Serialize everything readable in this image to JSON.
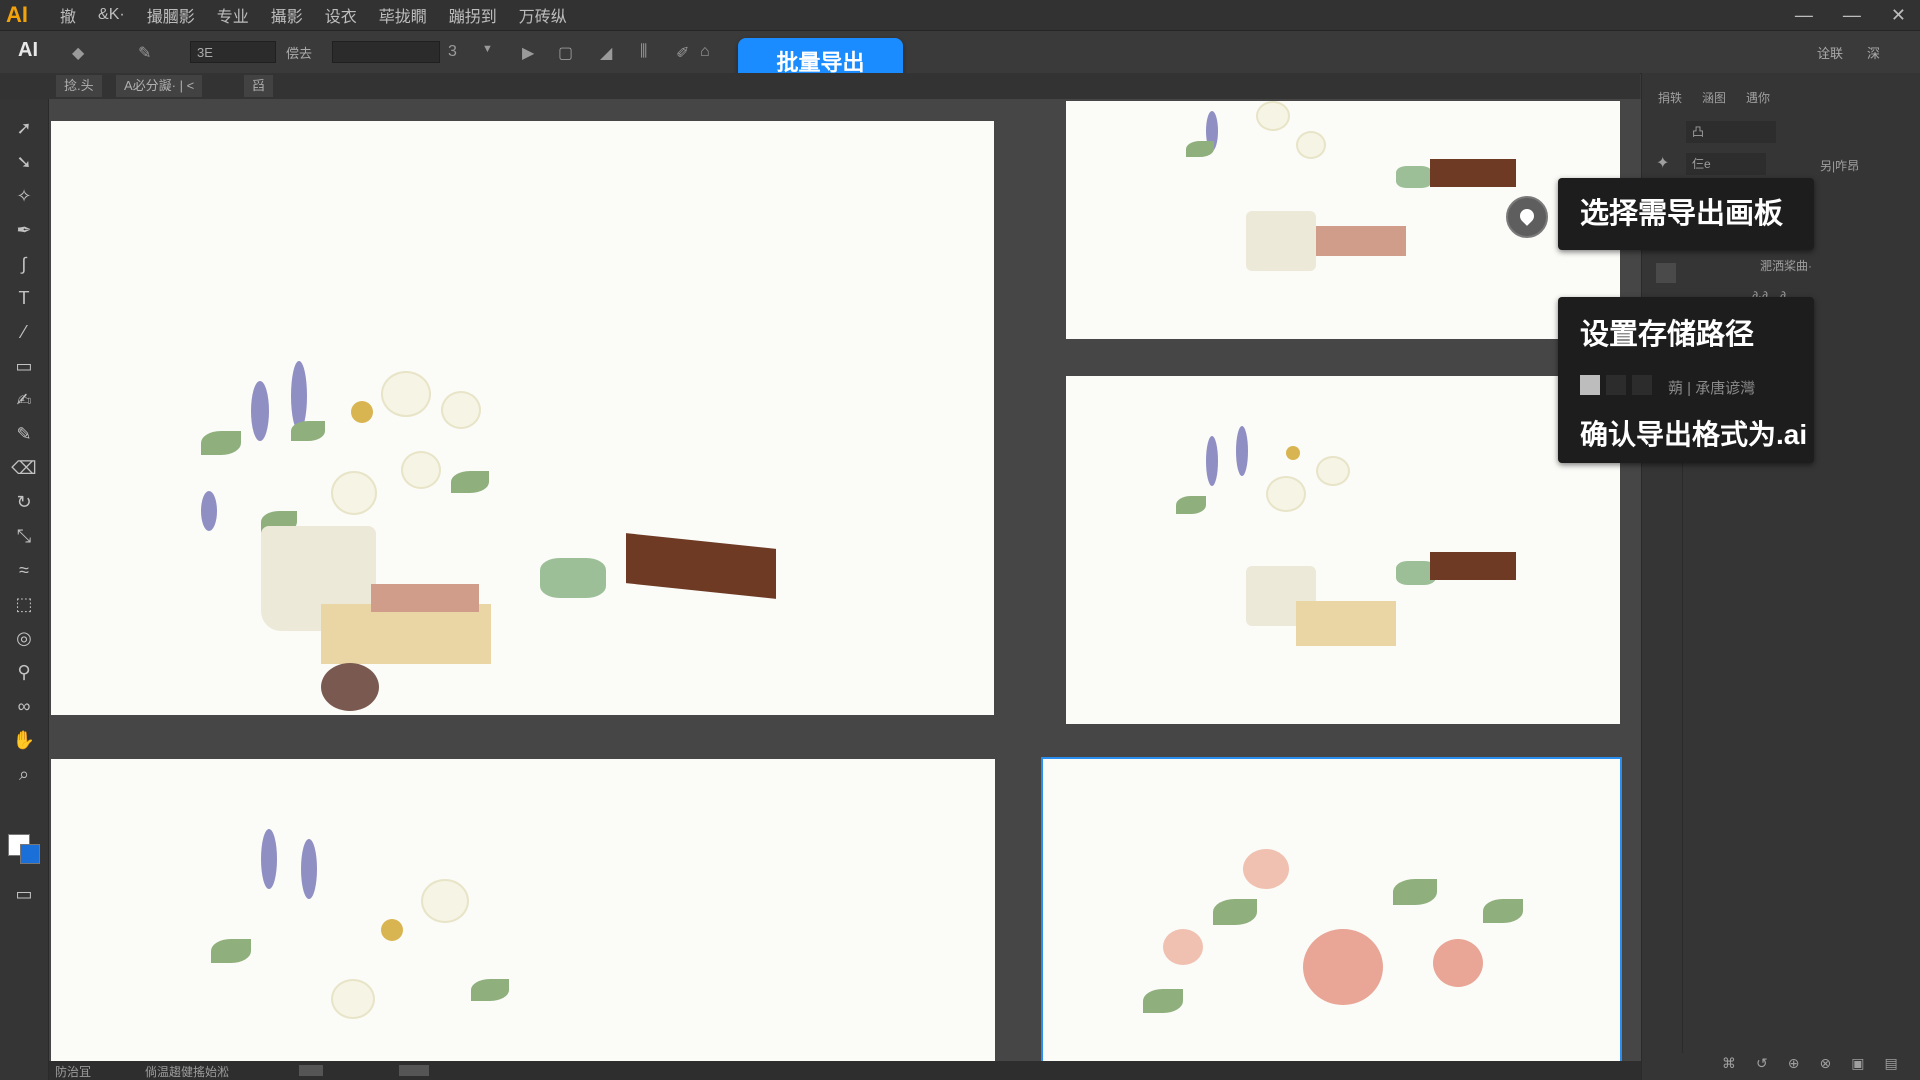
{
  "menubar": {
    "logo": "AI",
    "items": [
      "撤",
      "&K·",
      "撮膕影",
      "专业",
      "攝影",
      "设衣",
      "荜拢瞯",
      "蹦拐到",
      "万砖纵"
    ],
    "window_controls": [
      "—",
      "—",
      "✕"
    ]
  },
  "controlbar": {
    "logo": "AI",
    "field_stroke": "3E",
    "label_opacity": "偿去",
    "field_style": "",
    "field_size": "3",
    "batch_export_label": "批量导出",
    "right_items": [
      "诠联",
      "深"
    ]
  },
  "tabs": [
    "捻.头",
    "A必分譺·  |  <",
    "舀"
  ],
  "callouts": {
    "select_artboards": "选择需导出画板",
    "set_path": "设置存储路径",
    "path_placeholder": "蒴 | 承唐谚灣",
    "confirm_format": "确认导出格式为.ai"
  },
  "rightpanel": {
    "tabs": [
      "捐轶",
      "涵图",
      "遇你"
    ],
    "row1_field": "凸",
    "row2_label": "仨e",
    "row2_right": "另|咋昂",
    "layer_name": "淝洒桨曲·",
    "layer2": "∂·∂…∂",
    "bottom_icons": [
      "⌘",
      "↺",
      "⊕",
      "⊗",
      "▣",
      "▤"
    ]
  },
  "statusbar": {
    "left_text": "防治冝",
    "mid_text": "倘温趨健搖始淞"
  },
  "colors": {
    "accent": "#1a8cff",
    "logo": "#f2a20b",
    "selection": "#2a8ef0"
  }
}
